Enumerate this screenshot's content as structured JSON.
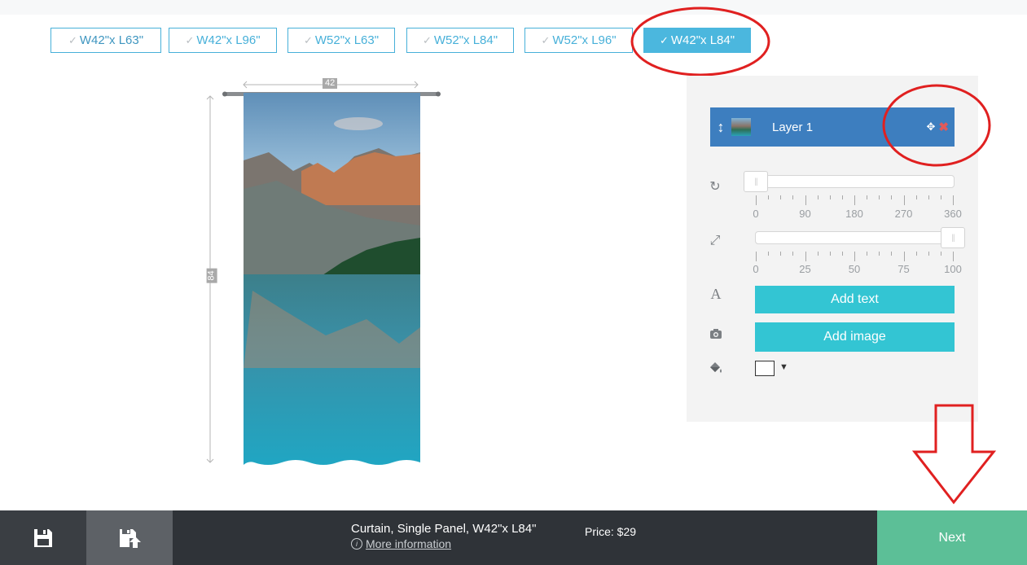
{
  "size_tabs": [
    {
      "label": "W42\"x L63\"",
      "selected": false
    },
    {
      "label": "W42\"x L96\"",
      "selected": false
    },
    {
      "label": "W52\"x L63\"",
      "selected": false
    },
    {
      "label": "W52\"x L84\"",
      "selected": false
    },
    {
      "label": "W52\"x L96\"",
      "selected": false
    },
    {
      "label": "W42\"x L84\"",
      "selected": true
    }
  ],
  "tab_check_glyph": "✓",
  "preview": {
    "width_label": "42",
    "height_label": "84"
  },
  "layers": [
    {
      "label": "Layer 1",
      "handle_glyph": "↕",
      "move_glyph": "✥",
      "delete_glyph": "✖"
    }
  ],
  "rotate_slider": {
    "icon": "rotate-icon",
    "icon_glyph": "↻",
    "value": 0,
    "min": 0,
    "max": 360,
    "tick_labels": [
      "0",
      "90",
      "180",
      "270",
      "360"
    ]
  },
  "scale_slider": {
    "icon": "resize-icon",
    "icon_glyph": "⤢",
    "value": 100,
    "min": 0,
    "max": 100,
    "tick_labels": [
      "0",
      "25",
      "50",
      "75",
      "100"
    ]
  },
  "actions": {
    "text_icon_glyph": "A",
    "add_text": "Add text",
    "image_icon_glyph": "📷",
    "add_image": "Add image",
    "fill_icon_glyph": "◆",
    "fill_color": "#ffffff",
    "fill_caret": "▼"
  },
  "bottom_bar": {
    "product_name": "Curtain, Single Panel, W42\"x L84\"",
    "info_glyph": "i",
    "more_info": "More information",
    "price": "Price: $29",
    "next": "Next"
  },
  "colors": {
    "accent_blue": "#4bb7de",
    "layer_blue": "#3d7ebf",
    "cyan_button": "#33c5d3",
    "next_green": "#5cbf97",
    "annotation_red": "#e02020"
  }
}
